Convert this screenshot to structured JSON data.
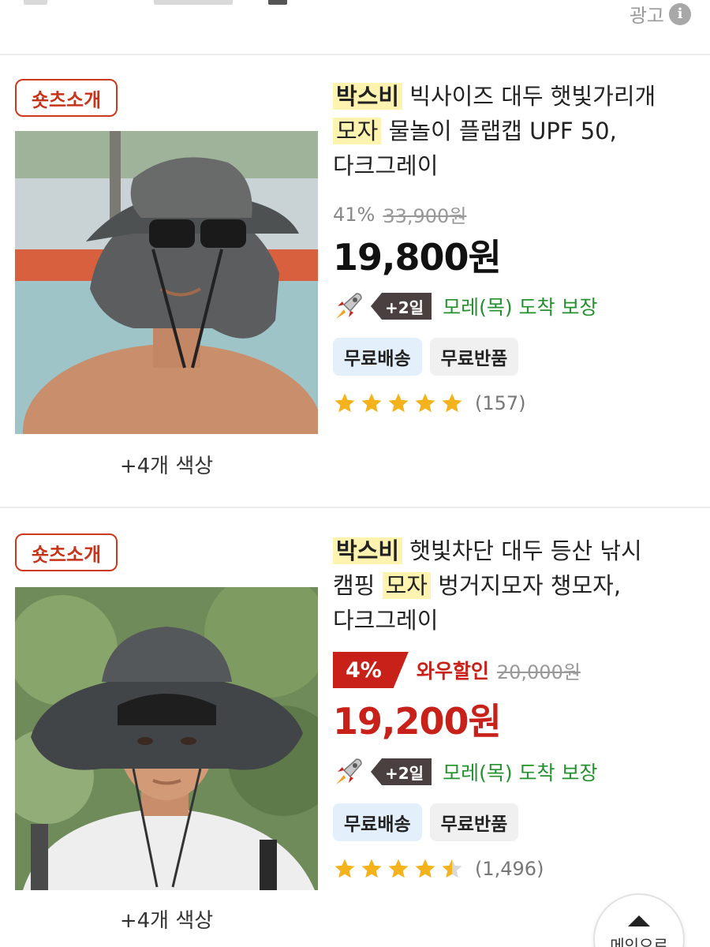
{
  "ad": {
    "label": "광고",
    "icon": "info-icon"
  },
  "products": [
    {
      "badge": "숏츠소개",
      "brand": "박스비",
      "title_part1": "빅사이즈 대두 햇빛가리개",
      "keyword": "모자",
      "title_part2": "물놀이 플랩캡 UPF 50,",
      "title_part3": "다크그레이",
      "discount": "41%",
      "original_price": "33,900원",
      "price": "19,800원",
      "delivery_badge": "+2일",
      "arrival": "모레(목) 도착 보장",
      "chips": [
        "무료배송",
        "무료반품"
      ],
      "rating": 5,
      "reviews": "(157)",
      "more_colors": "+4개 색상"
    },
    {
      "badge": "숏츠소개",
      "brand": "박스비",
      "title_part1": "햇빛차단 대두 등산 낚시",
      "title_part2a": "캠핑",
      "keyword": "모자",
      "title_part2b": "벙거지모자 챙모자,",
      "title_part3": "다크그레이",
      "wow_discount": "4%",
      "wow_label": "와우할인",
      "original_price": "20,000원",
      "price": "19,200원",
      "delivery_badge": "+2일",
      "arrival": "모레(목) 도착 보장",
      "chips": [
        "무료배송",
        "무료반품"
      ],
      "rating": 4.5,
      "reviews": "(1,496)",
      "more_colors": "+4개 색상"
    }
  ],
  "fab": {
    "label": "메인으로",
    "icon": "arrow-up-icon"
  },
  "colors": {
    "price_red": "#c8211a",
    "arrival_green": "#23912d",
    "badge_red": "#c7331a",
    "highlight": "#fff3b0"
  }
}
